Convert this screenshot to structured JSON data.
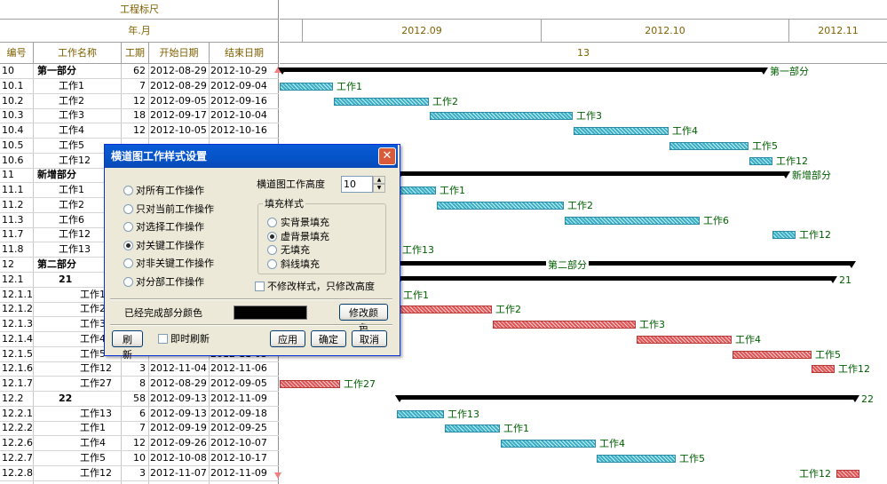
{
  "header": {
    "ruler_title": "工程标尺",
    "year_month_label": "年.月",
    "months": [
      "2012.09",
      "2012.10",
      "2012.11"
    ],
    "day_marker": "13"
  },
  "columns": [
    "编号",
    "工作名称",
    "工期",
    "开始日期",
    "结束日期"
  ],
  "rows": [
    {
      "id": "10",
      "name": "第一部分",
      "dur": "62",
      "start": "2012-08-29",
      "end": "2012-10-29",
      "bold": true,
      "indent": 0
    },
    {
      "id": "10.1",
      "name": "工作1",
      "dur": "7",
      "start": "2012-08-29",
      "end": "2012-09-04",
      "bold": false,
      "indent": 1
    },
    {
      "id": "10.2",
      "name": "工作2",
      "dur": "12",
      "start": "2012-09-05",
      "end": "2012-09-16",
      "bold": false,
      "indent": 1
    },
    {
      "id": "10.3",
      "name": "工作3",
      "dur": "18",
      "start": "2012-09-17",
      "end": "2012-10-04",
      "bold": false,
      "indent": 1
    },
    {
      "id": "10.4",
      "name": "工作4",
      "dur": "12",
      "start": "2012-10-05",
      "end": "2012-10-16",
      "bold": false,
      "indent": 1
    },
    {
      "id": "10.5",
      "name": "工作5",
      "dur": "",
      "start": "",
      "end": "",
      "bold": false,
      "indent": 1
    },
    {
      "id": "10.6",
      "name": "工作12",
      "dur": "",
      "start": "",
      "end": "",
      "bold": false,
      "indent": 1
    },
    {
      "id": "11",
      "name": "新增部分",
      "dur": "",
      "start": "",
      "end": "",
      "bold": true,
      "indent": 0
    },
    {
      "id": "11.1",
      "name": "工作1",
      "dur": "",
      "start": "",
      "end": "",
      "bold": false,
      "indent": 1
    },
    {
      "id": "11.2",
      "name": "工作2",
      "dur": "",
      "start": "",
      "end": "",
      "bold": false,
      "indent": 1
    },
    {
      "id": "11.3",
      "name": "工作6",
      "dur": "",
      "start": "",
      "end": "",
      "bold": false,
      "indent": 1
    },
    {
      "id": "11.7",
      "name": "工作12",
      "dur": "",
      "start": "",
      "end": "",
      "bold": false,
      "indent": 1
    },
    {
      "id": "11.8",
      "name": "工作13",
      "dur": "",
      "start": "",
      "end": "",
      "bold": false,
      "indent": 1
    },
    {
      "id": "12",
      "name": "第二部分",
      "dur": "",
      "start": "",
      "end": "",
      "bold": true,
      "indent": 0
    },
    {
      "id": "12.1",
      "name": "21",
      "dur": "",
      "start": "",
      "end": "",
      "bold": true,
      "indent": 1
    },
    {
      "id": "12.1.1",
      "name": "工作1",
      "dur": "",
      "start": "",
      "end": "",
      "bold": false,
      "indent": 2
    },
    {
      "id": "12.1.2",
      "name": "工作2",
      "dur": "",
      "start": "",
      "end": "",
      "bold": false,
      "indent": 2
    },
    {
      "id": "12.1.3",
      "name": "工作3",
      "dur": "",
      "start": "",
      "end": "",
      "bold": false,
      "indent": 2
    },
    {
      "id": "12.1.4",
      "name": "工作4",
      "dur": "",
      "start": "",
      "end": "",
      "bold": false,
      "indent": 2
    },
    {
      "id": "12.1.5",
      "name": "工作5",
      "dur": "",
      "start": "",
      "end": "2012-11-03",
      "bold": false,
      "indent": 2
    },
    {
      "id": "12.1.6",
      "name": "工作12",
      "dur": "3",
      "start": "2012-11-04",
      "end": "2012-11-06",
      "bold": false,
      "indent": 2
    },
    {
      "id": "12.1.7",
      "name": "工作27",
      "dur": "8",
      "start": "2012-08-29",
      "end": "2012-09-05",
      "bold": false,
      "indent": 2
    },
    {
      "id": "12.2",
      "name": "22",
      "dur": "58",
      "start": "2012-09-13",
      "end": "2012-11-09",
      "bold": true,
      "indent": 1
    },
    {
      "id": "12.2.1",
      "name": "工作13",
      "dur": "6",
      "start": "2012-09-13",
      "end": "2012-09-18",
      "bold": false,
      "indent": 2
    },
    {
      "id": "12.2.2",
      "name": "工作1",
      "dur": "7",
      "start": "2012-09-19",
      "end": "2012-09-25",
      "bold": false,
      "indent": 2
    },
    {
      "id": "12.2.6",
      "name": "工作4",
      "dur": "12",
      "start": "2012-09-26",
      "end": "2012-10-07",
      "bold": false,
      "indent": 2
    },
    {
      "id": "12.2.7",
      "name": "工作5",
      "dur": "10",
      "start": "2012-10-08",
      "end": "2012-10-17",
      "bold": false,
      "indent": 2
    },
    {
      "id": "12.2.8",
      "name": "工作12",
      "dur": "3",
      "start": "2012-11-07",
      "end": "2012-11-09",
      "bold": false,
      "indent": 2
    }
  ],
  "gantt_labels": [
    "第一部分",
    "工作1",
    "工作2",
    "工作3",
    "工作4",
    "工作5",
    "工作12",
    "新增部分",
    "工作1",
    "工作2",
    "工作6",
    "工作12",
    "工作13",
    "第二部分",
    "21",
    "工作1",
    "工作2",
    "工作3",
    "工作4",
    "工作5",
    "工作12",
    "工作27",
    "22",
    "工作13",
    "工作1",
    "工作4",
    "工作5",
    "工作12"
  ],
  "colors": {
    "gold": "#806000",
    "bar_label": "#006000",
    "normal_bar": "#3aaec4",
    "critical_bar": "#e05555"
  },
  "dialog": {
    "title": "横道图工作样式设置",
    "close_icon": "✕",
    "options": [
      "对所有工作操作",
      "只对当前工作操作",
      "对选择工作操作",
      "对关键工作操作",
      "对非关键工作操作",
      "对分部工作操作"
    ],
    "selected_option": "对关键工作操作",
    "height_label": "横道图工作高度",
    "height_value": "10",
    "fill_group_label": "填充样式",
    "fill_options": [
      "实背景填充",
      "虚背景填充",
      "无填充",
      "斜线填充"
    ],
    "selected_fill": "虚背景填充",
    "keep_style_label": "不修改样式，只修改高度",
    "completed_color_label": "已经完成部分颜色",
    "completed_color": "#000000",
    "change_color_button": "修改颜色",
    "refresh_button": "刷新",
    "instant_refresh_label": "即时刷新",
    "apply_button": "应用",
    "ok_button": "确定",
    "cancel_button": "取消"
  }
}
